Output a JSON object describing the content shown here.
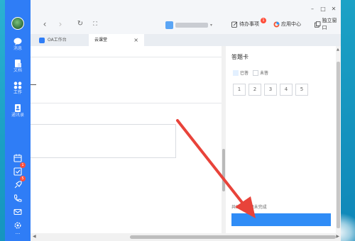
{
  "window": {
    "minimize_glyph": "–",
    "maximize_glyph": "□",
    "close_glyph": "✕"
  },
  "sidebar": {
    "items": [
      {
        "label": "消息",
        "icon": "chat-icon"
      },
      {
        "label": "文档",
        "icon": "document-icon"
      },
      {
        "label": "工作",
        "icon": "workspace-grid-icon"
      },
      {
        "label": "通讯录",
        "icon": "contacts-icon"
      }
    ],
    "bottom_icons": [
      {
        "icon": "calendar-icon",
        "badge": ""
      },
      {
        "icon": "todo-check-icon",
        "badge": "1"
      },
      {
        "icon": "rocket-icon",
        "badge": "5"
      },
      {
        "icon": "phone-icon",
        "badge": ""
      },
      {
        "icon": "mail-icon",
        "badge": ""
      },
      {
        "icon": "settings-icon",
        "badge": ""
      }
    ],
    "more": "···"
  },
  "toolbar": {
    "back": "‹",
    "forward": "›",
    "refresh": "↻",
    "fullscreen": "⛶",
    "account_caret": "▾",
    "todo_label": "待办事项",
    "todo_badge": "1",
    "apps_label": "应用中心",
    "standalone_label": "独立窗口"
  },
  "tabs": [
    {
      "label": "OA工作台",
      "active": false
    },
    {
      "label": "云课堂",
      "active": true,
      "close": "×"
    }
  ],
  "answer_card": {
    "title": "答题卡",
    "legend_done": "已答",
    "legend_todo": "未答",
    "questions": [
      "1",
      "2",
      "3",
      "4",
      "5"
    ],
    "summary": "共5题，5题未完成"
  },
  "colors": {
    "sidebar": "#2f7df6",
    "submit": "#2f8cf6",
    "arrow": "#e8433a"
  }
}
